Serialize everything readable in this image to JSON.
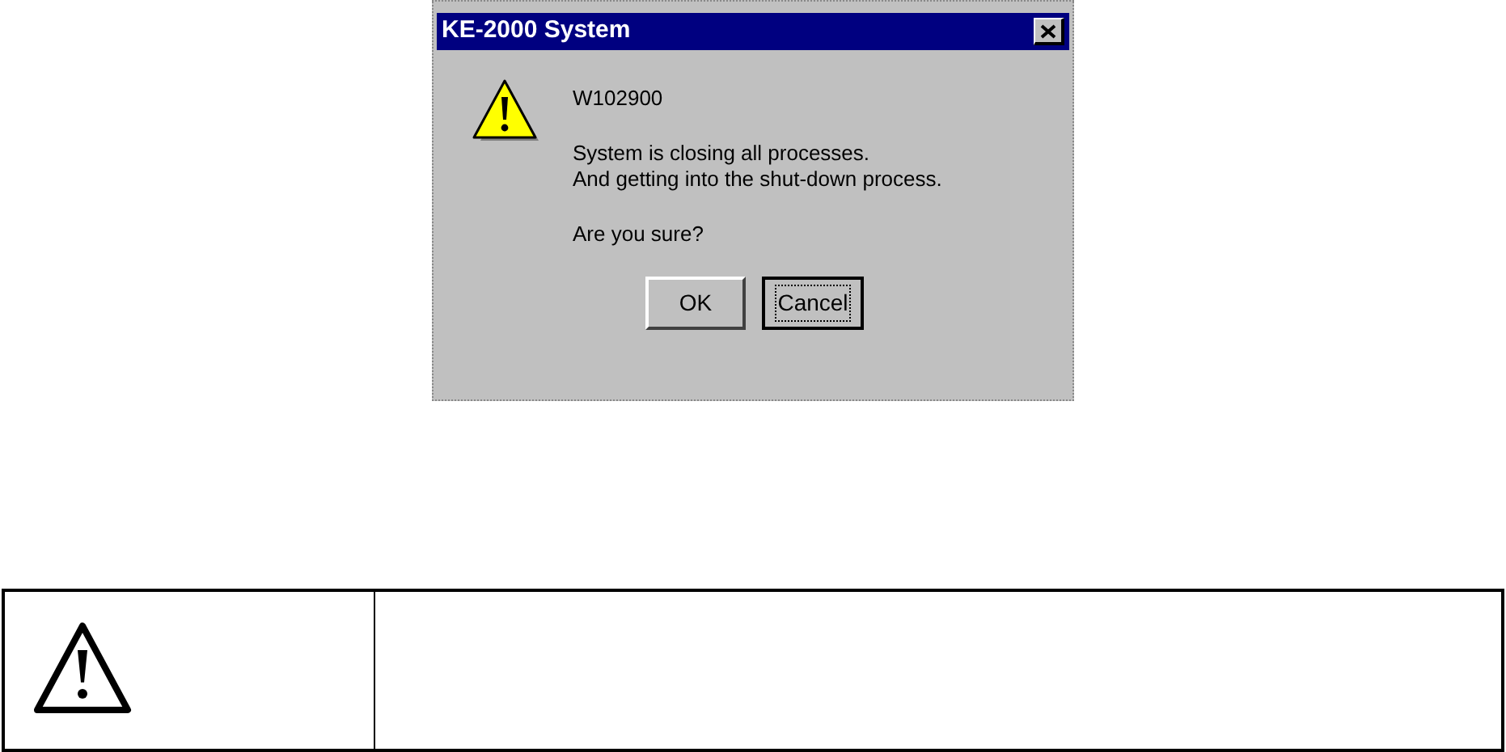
{
  "dialog": {
    "title": "KE-2000 System",
    "code": "W102900",
    "message_lines": [
      "System is closing all processes.",
      "And getting into the shut-down process."
    ],
    "question": "Are you sure?",
    "buttons": [
      {
        "label": "OK",
        "focused": false
      },
      {
        "label": "Cancel",
        "focused": true
      }
    ]
  }
}
